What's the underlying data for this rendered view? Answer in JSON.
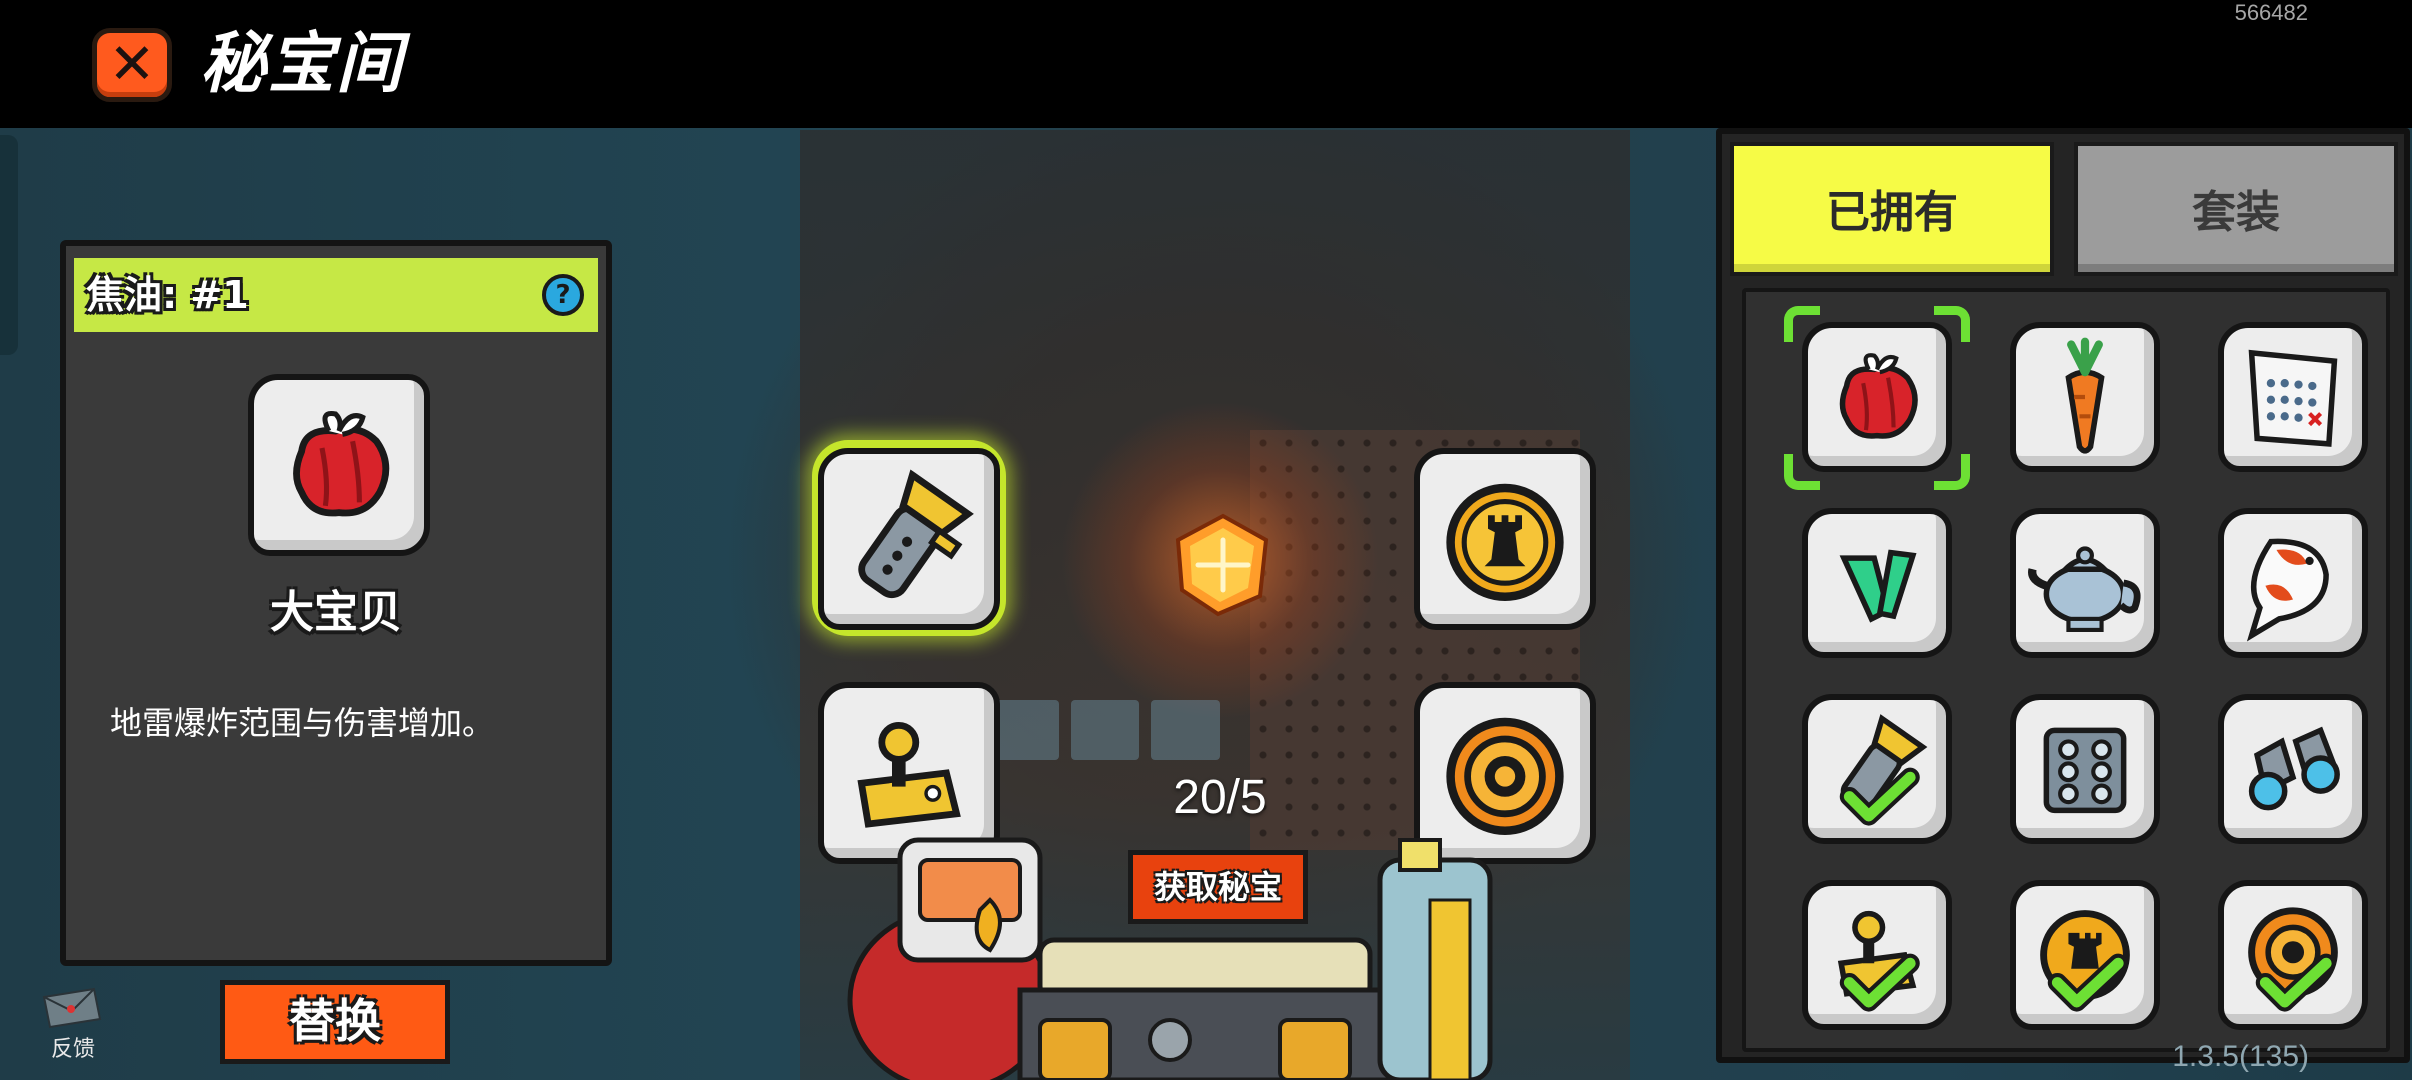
{
  "header": {
    "title": "秘宝间",
    "close_icon": "close-x-icon",
    "uid": "566482"
  },
  "info_card": {
    "header_label": "焦油: #1",
    "help_icon": "question-icon",
    "item_icon": "red-pepper-gift-icon",
    "item_name": "大宝贝",
    "description": "地雷爆炸范围与伤害增加。"
  },
  "actions": {
    "replace_label": "替换",
    "get_treasure_label": "获取秘宝"
  },
  "feedback": {
    "icon": "envelope-icon",
    "label": "反馈"
  },
  "center": {
    "counter": "20/5",
    "slots": [
      {
        "icon": "flashlight-icon",
        "selected": true
      },
      {
        "icon": "chess-rook-badge-icon",
        "selected": false
      },
      {
        "icon": "joystick-icon",
        "selected": false
      },
      {
        "icon": "orange-ring-icon",
        "selected": false
      }
    ],
    "core_icon": "glowing-orange-gem-icon"
  },
  "inventory": {
    "tabs": [
      {
        "label": "已拥有",
        "active": true
      },
      {
        "label": "套装",
        "active": false
      }
    ],
    "items": [
      {
        "icon": "red-pepper-gift-icon",
        "selected": true,
        "equipped": false
      },
      {
        "icon": "carrot-icon",
        "selected": false,
        "equipped": false
      },
      {
        "icon": "dotted-paper-icon",
        "selected": false,
        "equipped": false
      },
      {
        "icon": "green-arrows-icon",
        "selected": false,
        "equipped": false
      },
      {
        "icon": "teapot-icon",
        "selected": false,
        "equipped": false
      },
      {
        "icon": "koi-fish-icon",
        "selected": false,
        "equipped": false
      },
      {
        "icon": "flashlight-icon",
        "selected": false,
        "equipped": true
      },
      {
        "icon": "six-dot-plate-icon",
        "selected": false,
        "equipped": false
      },
      {
        "icon": "binoculars-icon",
        "selected": false,
        "equipped": false
      },
      {
        "icon": "joystick-icon",
        "selected": false,
        "equipped": true
      },
      {
        "icon": "chess-rook-badge-icon",
        "selected": false,
        "equipped": true
      },
      {
        "icon": "orange-ring-icon",
        "selected": false,
        "equipped": true
      }
    ]
  },
  "footer": {
    "version": "1.3.5(135)"
  },
  "colors": {
    "accent_yellow": "#f6fb46",
    "accent_lime": "#c6e845",
    "accent_orange": "#ff5a14",
    "check_green": "#6de034"
  }
}
